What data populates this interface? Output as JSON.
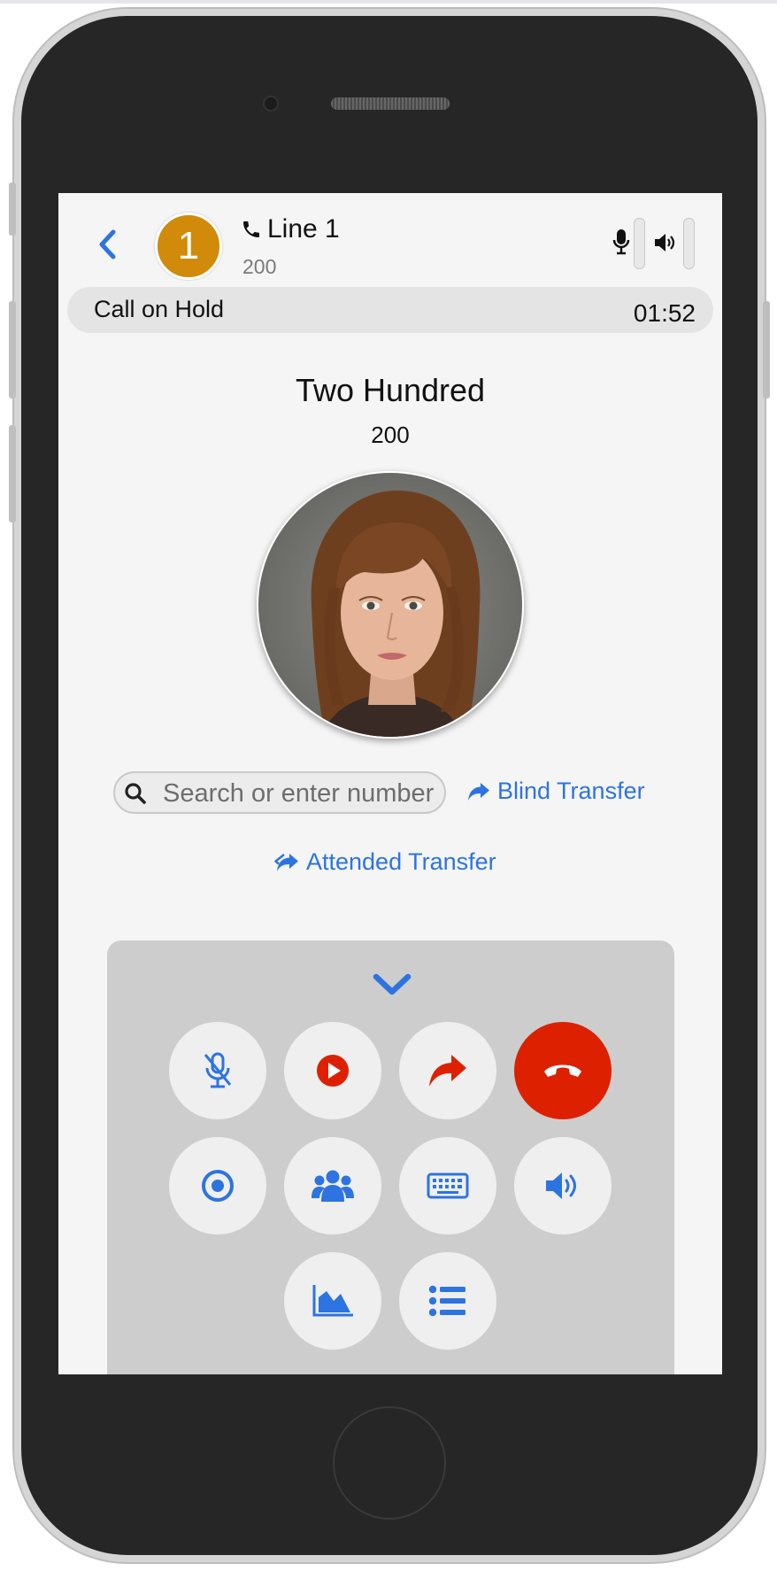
{
  "header": {
    "line_number": "1",
    "line_label": "Line 1",
    "line_extension": "200"
  },
  "status": {
    "text": "Call on Hold",
    "timer": "01:52"
  },
  "caller": {
    "name": "Two Hundred",
    "number": "200"
  },
  "transfer": {
    "search_placeholder": "Search or enter number",
    "blind_label": "Blind Transfer",
    "attended_label": "Attended Transfer"
  },
  "controls": [
    {
      "icon": "mic-muted-icon"
    },
    {
      "icon": "play-icon"
    },
    {
      "icon": "forward-icon"
    },
    {
      "icon": "hang-up-icon"
    },
    {
      "icon": "record-icon"
    },
    {
      "icon": "conference-icon"
    },
    {
      "icon": "keypad-icon"
    },
    {
      "icon": "speaker-icon"
    },
    {
      "icon": "stats-chart-icon"
    },
    {
      "icon": "list-icon"
    }
  ],
  "colors": {
    "accent": "#2d74e0",
    "line_badge": "#d18a0a",
    "end_call": "#dd2100",
    "screen_bg": "#f5f5f5",
    "controls_bg": "#cdcdcd"
  }
}
